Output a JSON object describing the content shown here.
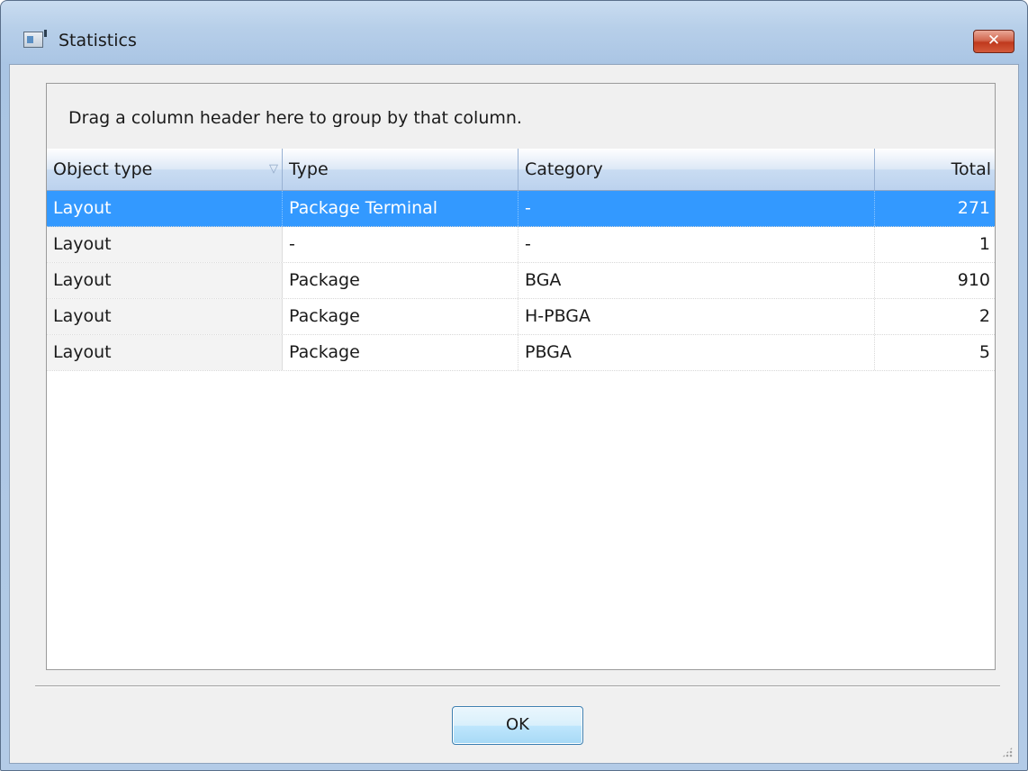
{
  "window": {
    "title": "Statistics",
    "close_label": "✕"
  },
  "grid": {
    "group_hint": "Drag a column header here to group by that column.",
    "columns": [
      {
        "label": "Object type",
        "sort_indicator": "▽"
      },
      {
        "label": "Type"
      },
      {
        "label": "Category"
      },
      {
        "label": "Total"
      }
    ],
    "rows": [
      {
        "object_type": "Layout",
        "type": "Package Terminal",
        "category": "-",
        "total": "271",
        "selected": true
      },
      {
        "object_type": "Layout",
        "type": "-",
        "category": "-",
        "total": "1"
      },
      {
        "object_type": "Layout",
        "type": "Package",
        "category": "BGA",
        "total": "910"
      },
      {
        "object_type": "Layout",
        "type": "Package",
        "category": "H-PBGA",
        "total": "2"
      },
      {
        "object_type": "Layout",
        "type": "Package",
        "category": "PBGA",
        "total": "5"
      }
    ]
  },
  "footer": {
    "ok_label": "OK"
  },
  "colors": {
    "selection": "#3399ff",
    "close_button": "#c7432a",
    "header_gradient": "#c9dcf2"
  }
}
